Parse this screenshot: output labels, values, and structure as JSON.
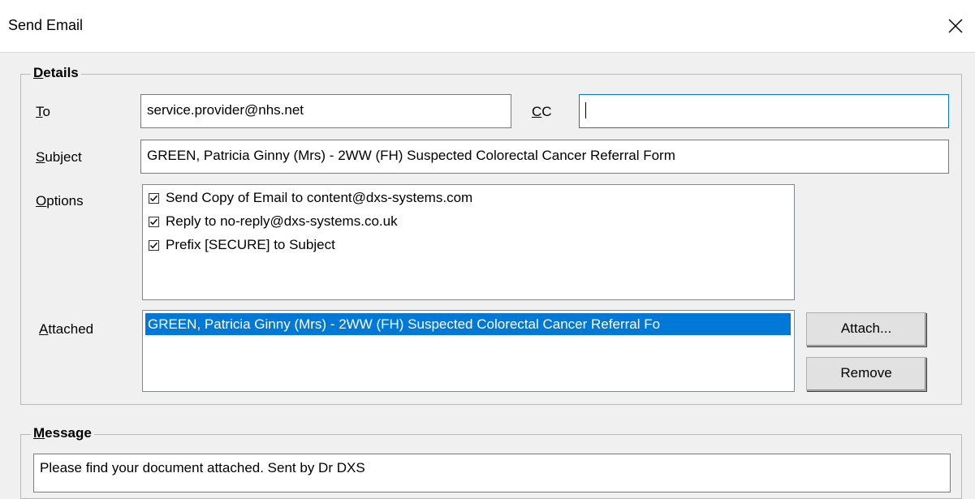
{
  "window": {
    "title": "Send Email"
  },
  "details": {
    "legend": "Details",
    "to_label": "To",
    "to_value": "service.provider@nhs.net",
    "cc_label": "CC",
    "cc_value": "",
    "subject_label": "Subject",
    "subject_value": "GREEN, Patricia Ginny (Mrs) - 2WW (FH) Suspected Colorectal Cancer Referral Form",
    "options_label": "Options",
    "options": [
      {
        "label": "Send Copy of Email to content@dxs-systems.com",
        "checked": true
      },
      {
        "label": "Reply to no-reply@dxs-systems.co.uk",
        "checked": true
      },
      {
        "label": "Prefix [SECURE] to Subject",
        "checked": true
      }
    ],
    "attached_label": "Attached",
    "attached_items": [
      {
        "label": "GREEN, Patricia Ginny (Mrs) - 2WW (FH) Suspected Colorectal Cancer Referral Fo",
        "selected": true
      }
    ],
    "attach_button": "Attach...",
    "remove_button": "Remove"
  },
  "message": {
    "legend": "Message",
    "body": "Please find your document attached.  Sent by Dr DXS"
  },
  "colors": {
    "selection": "#0078d7",
    "focus_border": "#0078d7"
  }
}
